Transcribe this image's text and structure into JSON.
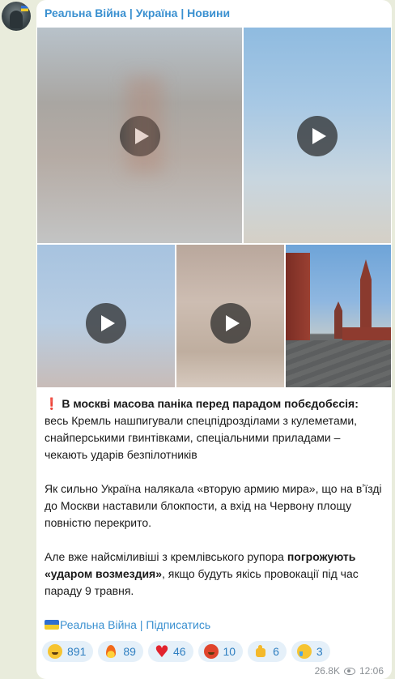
{
  "channel": {
    "name": "Реальна Війна | Україна | Новини"
  },
  "media": [
    {
      "type": "video"
    },
    {
      "type": "video"
    },
    {
      "type": "video"
    },
    {
      "type": "video"
    },
    {
      "type": "photo"
    }
  ],
  "message": {
    "p1_icon": "❗",
    "p1_bold": "В москві масова паніка перед парадом побєдобєсія:",
    "p1_rest": " весь Кремль нашпигували спецпідрозділами з кулеметами, снайперськими гвинтівками, спеціальними приладами – чекають ударів безпілотників",
    "p2": "Як сильно Україна налякала «вторую армию мира», що на вʼїзді до Москви наставили блокпости, а вхід на Червону площу повністю перекрито.",
    "p3_a": "Але вже найсміливіші з кремлівського рупора ",
    "p3_bold1": "погрожують «ударом возмездия»",
    "p3_b": ", якщо будуть якісь провокації під час параду 9 травня.",
    "footer_channel": "Реальна Війна",
    "footer_sep": " | ",
    "footer_subscribe": "Підписатись"
  },
  "reactions": [
    {
      "emoji": "grinning-face",
      "count": "891"
    },
    {
      "emoji": "fire",
      "count": "89"
    },
    {
      "emoji": "red-heart",
      "count": "46"
    },
    {
      "emoji": "angry-face",
      "count": "10"
    },
    {
      "emoji": "thumbs-up",
      "count": "6"
    },
    {
      "emoji": "crying-face",
      "count": "3"
    }
  ],
  "meta": {
    "views": "26.8K",
    "time": "12:06"
  },
  "colors": {
    "accent": "#3a90d0",
    "background": "#e9ecdc",
    "reaction_bg": "#e5f0f9"
  }
}
